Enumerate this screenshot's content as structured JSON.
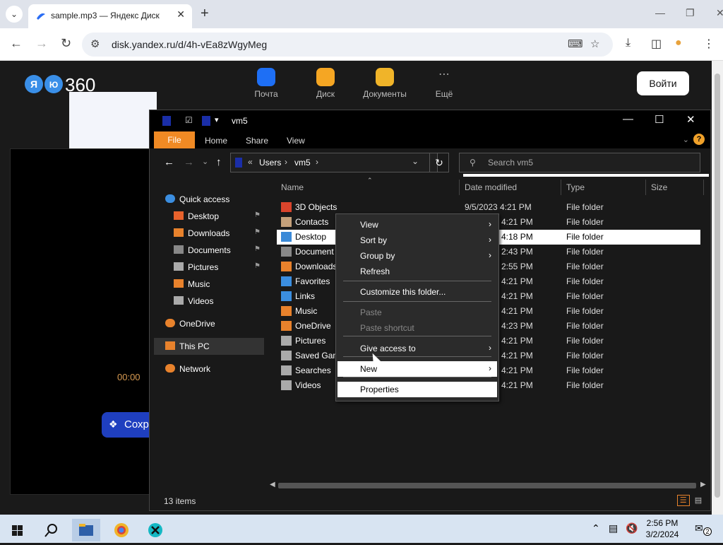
{
  "browser": {
    "tab_title": "sample.mp3 — Яндекс Диск",
    "url": "disk.yandex.ru/d/4h-vEa8zWgyMeg"
  },
  "yandex": {
    "logo_text": "360",
    "apps": [
      {
        "label": "Почта",
        "color": "#1e6ff5"
      },
      {
        "label": "Диск",
        "color": "#f5a623"
      },
      {
        "label": "Документы",
        "color": "#f0b429"
      },
      {
        "label": "Ещё",
        "color": "#1a1a1a"
      }
    ],
    "login_label": "Войти",
    "player_time": "00:00",
    "save_label": "Сохра"
  },
  "explorer": {
    "title": "vm5",
    "ribbon_tabs": [
      "File",
      "Home",
      "Share",
      "View"
    ],
    "breadcrumb": [
      "Users",
      "vm5"
    ],
    "search_placeholder": "Search vm5",
    "columns": [
      "Name",
      "Date modified",
      "Type",
      "Size"
    ],
    "sidebar": [
      {
        "label": "Quick access",
        "icon": "star-icon",
        "color": "#3b8ee0",
        "pinned": false
      },
      {
        "label": "Desktop",
        "icon": "desktop-folder-icon",
        "color": "#e8622c",
        "pinned": true
      },
      {
        "label": "Downloads",
        "icon": "download-arrow-icon",
        "color": "#e8822c",
        "pinned": true
      },
      {
        "label": "Documents",
        "icon": "document-icon",
        "color": "#888888",
        "pinned": true
      },
      {
        "label": "Pictures",
        "icon": "pictures-icon",
        "color": "#aaaaaa",
        "pinned": true
      },
      {
        "label": "Music",
        "icon": "music-note-icon",
        "color": "#e8822c",
        "pinned": false
      },
      {
        "label": "Videos",
        "icon": "film-icon",
        "color": "#aaaaaa",
        "pinned": false
      },
      {
        "label": "OneDrive",
        "icon": "cloud-icon",
        "color": "#e8822c",
        "pinned": false
      },
      {
        "label": "This PC",
        "icon": "computer-icon",
        "color": "#e8822c",
        "pinned": false
      },
      {
        "label": "Network",
        "icon": "network-icon",
        "color": "#e8822c",
        "pinned": false
      }
    ],
    "files": [
      {
        "name": "3D Objects",
        "date": "9/5/2023 4:21 PM",
        "type": "File folder",
        "icon": "cube-folder-icon",
        "color": "#d9442c"
      },
      {
        "name": "Contacts",
        "date": "4:21 PM",
        "type": "File folder",
        "icon": "contacts-icon",
        "color": "#c4a07a"
      },
      {
        "name": "Desktop",
        "date": "4:18 PM",
        "type": "File folder",
        "icon": "desktop-folder-icon",
        "color": "#3a8ad8"
      },
      {
        "name": "Document",
        "date": "2:43 PM",
        "type": "File folder",
        "icon": "document-icon",
        "color": "#888888"
      },
      {
        "name": "Downloads",
        "date": "2:55 PM",
        "type": "File folder",
        "icon": "download-arrow-icon",
        "color": "#e8822c"
      },
      {
        "name": "Favorites",
        "date": "4:21 PM",
        "type": "File folder",
        "icon": "star-icon",
        "color": "#3b8ee0"
      },
      {
        "name": "Links",
        "date": "4:21 PM",
        "type": "File folder",
        "icon": "link-icon",
        "color": "#3b8ee0"
      },
      {
        "name": "Music",
        "date": "4:21 PM",
        "type": "File folder",
        "icon": "music-note-icon",
        "color": "#e8822c"
      },
      {
        "name": "OneDrive",
        "date": "4:23 PM",
        "type": "File folder",
        "icon": "cloud-icon",
        "color": "#e8822c"
      },
      {
        "name": "Pictures",
        "date": "4:21 PM",
        "type": "File folder",
        "icon": "pictures-icon",
        "color": "#aaaaaa"
      },
      {
        "name": "Saved Gam",
        "date": "4:21 PM",
        "type": "File folder",
        "icon": "game-icon",
        "color": "#aaaaaa"
      },
      {
        "name": "Searches",
        "date": "4:21 PM",
        "type": "File folder",
        "icon": "search-icon",
        "color": "#aaaaaa"
      },
      {
        "name": "Videos",
        "date": "4:21 PM",
        "type": "File folder",
        "icon": "film-icon",
        "color": "#aaaaaa"
      }
    ],
    "status": "13 items"
  },
  "context_menu": {
    "items": [
      {
        "label": "View",
        "submenu": true,
        "disabled": false
      },
      {
        "label": "Sort by",
        "submenu": true,
        "disabled": false
      },
      {
        "label": "Group by",
        "submenu": true,
        "disabled": false
      },
      {
        "label": "Refresh",
        "submenu": false,
        "disabled": false
      },
      {
        "label": "Customize this folder...",
        "submenu": false,
        "disabled": false
      },
      {
        "label": "Paste",
        "submenu": false,
        "disabled": true
      },
      {
        "label": "Paste shortcut",
        "submenu": false,
        "disabled": true
      },
      {
        "label": "Give access to",
        "submenu": true,
        "disabled": false
      },
      {
        "label": "New",
        "submenu": true,
        "disabled": false
      },
      {
        "label": "Properties",
        "submenu": false,
        "disabled": false
      }
    ]
  },
  "taskbar": {
    "time": "2:56 PM",
    "date": "3/2/2024",
    "notification_count": "2"
  }
}
